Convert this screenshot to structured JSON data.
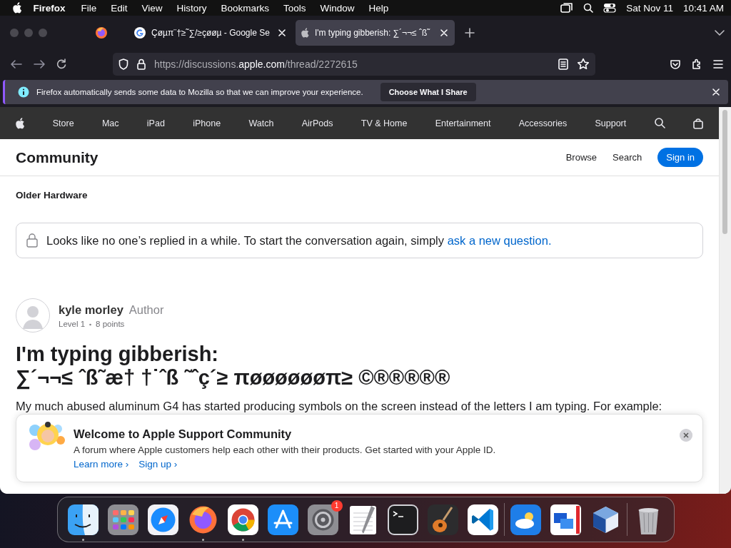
{
  "menubar": {
    "app": "Firefox",
    "menus": [
      "File",
      "Edit",
      "View",
      "History",
      "Bookmarks",
      "Tools",
      "Window",
      "Help"
    ],
    "date": "Sat Nov 11",
    "time": "10:41 AM"
  },
  "browser": {
    "tabs": [
      {
        "kind": "firefox",
        "selected": false
      },
      {
        "kind": "google",
        "title": "Çøµπ¨†≥˜∑/≥çøøµ - Google Se",
        "selected": false
      },
      {
        "kind": "apple",
        "title": "I'm typing gibberish: ∑´¬¬≤ ˆß˜",
        "selected": true
      }
    ],
    "url_prefix": "https://discussions.",
    "url_domain": "apple.com",
    "url_path": "/thread/2272615"
  },
  "notification": {
    "message": "Firefox automatically sends some data to Mozilla so that we can improve your experience.",
    "button": "Choose What I Share"
  },
  "site_nav": {
    "items": [
      "Store",
      "Mac",
      "iPad",
      "iPhone",
      "Watch",
      "AirPods",
      "TV & Home",
      "Entertainment",
      "Accessories",
      "Support"
    ]
  },
  "community": {
    "title": "Community",
    "links": [
      "Browse",
      "Search"
    ],
    "sign_in": "Sign in"
  },
  "breadcrumb": "Older Hardware",
  "notice": {
    "text": "Looks like no one’s replied in a while. To start the conversation again, simply",
    "link": "ask a new question."
  },
  "post": {
    "author": "kyle morley",
    "role": "Author",
    "level": "Level 1",
    "points": "8 points",
    "title_lines": [
      "I'm typing gibberish:",
      "∑´¬¬≤ ˆß˜æ† †˙ˆß ˜ˆç´≥ πøøøøøøπ≥  ©®®®®®"
    ],
    "body": "My much abused aluminum G4 has started producing symbols on the screen instead of the letters I am typing. For example:"
  },
  "welcome": {
    "title": "Welcome to Apple Support Community",
    "text": "A forum where Apple customers help each other with their products. Get started with your Apple ID.",
    "links": [
      "Learn more ›",
      "Sign up ›"
    ]
  },
  "dock": {
    "groups": [
      {
        "apps": [
          {
            "kind": "finder",
            "running": true
          },
          {
            "kind": "launchpad",
            "running": false
          },
          {
            "kind": "safari",
            "running": false
          },
          {
            "kind": "firefox",
            "running": true
          },
          {
            "kind": "chrome",
            "running": true
          },
          {
            "kind": "appstore",
            "running": false
          },
          {
            "kind": "settings",
            "running": false,
            "badge": "1"
          },
          {
            "kind": "textedit",
            "running": false
          },
          {
            "kind": "terminal",
            "running": false
          },
          {
            "kind": "guitar",
            "running": false
          },
          {
            "kind": "vscode",
            "running": false
          }
        ]
      },
      {
        "apps": [
          {
            "kind": "weather",
            "running": false
          },
          {
            "kind": "windows",
            "running": false
          },
          {
            "kind": "cube",
            "running": false
          }
        ]
      },
      {
        "apps": [
          {
            "kind": "trash",
            "running": false
          }
        ]
      }
    ]
  }
}
